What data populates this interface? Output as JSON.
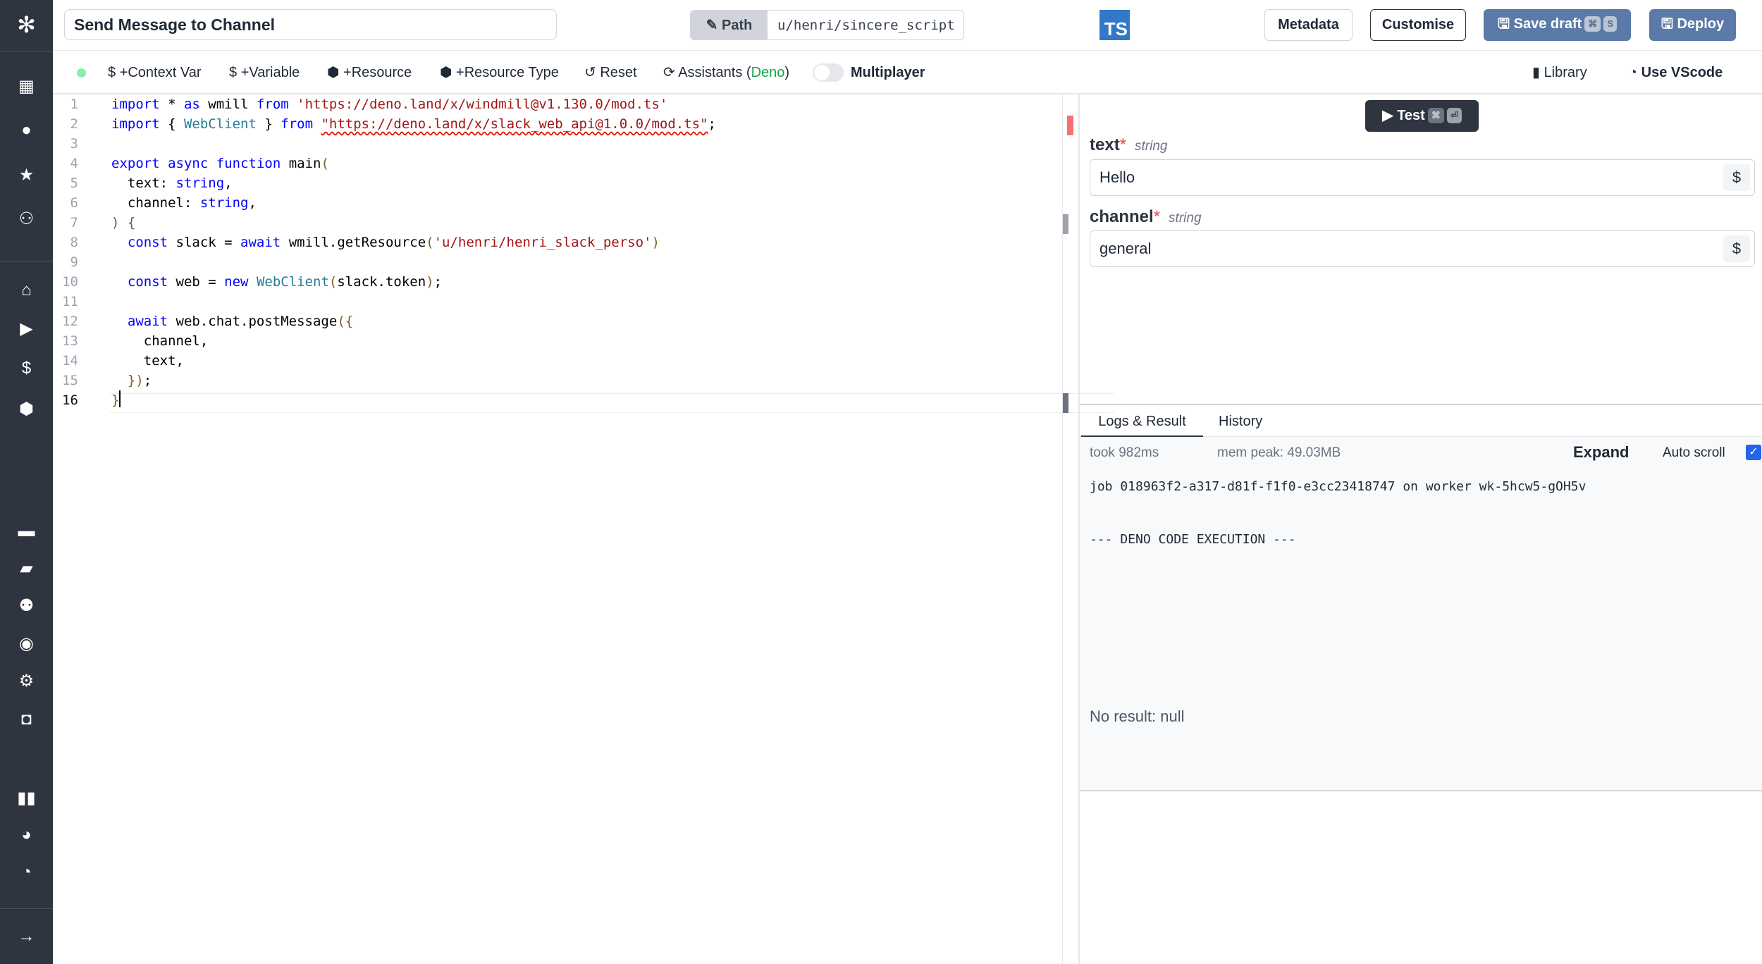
{
  "sidebar": {
    "icons": [
      "windmill-logo",
      "building-icon",
      "user-icon",
      "star-icon",
      "users-icon",
      "home-icon",
      "play-icon",
      "dollar-icon",
      "cubes-icon",
      "calendar-icon",
      "folder-icon",
      "groups-icon",
      "eye-icon",
      "gear-icon",
      "robot-icon",
      "book-icon",
      "discord-icon",
      "github-icon",
      "arrow-right-icon"
    ]
  },
  "header": {
    "title": "Send Message to Channel",
    "path_label": "Path",
    "path_value": "u/henri/sincere_script",
    "lang_badge": "TS",
    "metadata": "Metadata",
    "customise": "Customise",
    "save_draft": "Save draft",
    "save_kbd1": "⌘",
    "save_kbd2": "S",
    "deploy": "Deploy",
    "accent": "#5b7aa8"
  },
  "toolbar": {
    "context_var": "+Context Var",
    "variable": "+Variable",
    "resource": "+Resource",
    "resource_type": "+Resource Type",
    "reset": "Reset",
    "assistants": "Assistants (",
    "assistants_deno": "Deno",
    "assistants_close": ")",
    "multiplayer": "Multiplayer",
    "multiplayer_on": false,
    "library": "Library",
    "use_vscode": "Use VScode",
    "status_color": "#86efac"
  },
  "editor": {
    "lines": [
      [
        [
          "kw",
          "import"
        ],
        [
          "pl",
          " * "
        ],
        [
          "kw",
          "as"
        ],
        [
          "pl",
          " wmill "
        ],
        [
          "kw",
          "from"
        ],
        [
          "pl",
          " "
        ],
        [
          "st",
          "'https://deno.land/x/windmill@v1.130.0/mod.ts'"
        ]
      ],
      [
        [
          "kw",
          "import"
        ],
        [
          "pl",
          " { "
        ],
        [
          "ty",
          "WebClient"
        ],
        [
          "pl",
          " } "
        ],
        [
          "kw",
          "from"
        ],
        [
          "pl",
          " "
        ],
        [
          "stq",
          "\"https://deno.land/x/slack_web_api@1.0.0/mod.ts\""
        ],
        [
          "pl",
          ";"
        ]
      ],
      [],
      [
        [
          "kw",
          "export"
        ],
        [
          "pl",
          " "
        ],
        [
          "kw",
          "async"
        ],
        [
          "pl",
          " "
        ],
        [
          "kw",
          "function"
        ],
        [
          "pl",
          " main"
        ],
        [
          "br",
          "("
        ]
      ],
      [
        [
          "pl",
          "  text: "
        ],
        [
          "kw",
          "string"
        ],
        [
          "pl",
          ","
        ]
      ],
      [
        [
          "pl",
          "  channel: "
        ],
        [
          "kw",
          "string"
        ],
        [
          "pl",
          ","
        ]
      ],
      [
        [
          "br",
          ")"
        ],
        [
          "pl",
          " "
        ],
        [
          "br",
          "{"
        ]
      ],
      [
        [
          "pl",
          "  "
        ],
        [
          "kw",
          "const"
        ],
        [
          "pl",
          " slack = "
        ],
        [
          "kw",
          "await"
        ],
        [
          "pl",
          " wmill.getResource"
        ],
        [
          "br",
          "("
        ],
        [
          "st",
          "'u/henri/henri_slack_perso'"
        ],
        [
          "br",
          ")"
        ]
      ],
      [],
      [
        [
          "pl",
          "  "
        ],
        [
          "kw",
          "const"
        ],
        [
          "pl",
          " web = "
        ],
        [
          "kw",
          "new"
        ],
        [
          "pl",
          " "
        ],
        [
          "ty",
          "WebClient"
        ],
        [
          "br",
          "("
        ],
        [
          "pl",
          "slack.token"
        ],
        [
          "br",
          ")"
        ],
        [
          "pl",
          ";"
        ]
      ],
      [],
      [
        [
          "pl",
          "  "
        ],
        [
          "kw",
          "await"
        ],
        [
          "pl",
          " web.chat.postMessage"
        ],
        [
          "br",
          "({"
        ]
      ],
      [
        [
          "pl",
          "    channel,"
        ]
      ],
      [
        [
          "pl",
          "    text,"
        ]
      ],
      [
        [
          "pl",
          "  "
        ],
        [
          "br",
          "})"
        ],
        [
          "pl",
          ";"
        ]
      ],
      [
        [
          "br",
          "}"
        ]
      ]
    ]
  },
  "test": {
    "label": "Test",
    "kbd1": "⌘",
    "kbd2": "⏎"
  },
  "args": [
    {
      "name": "text",
      "type": "string",
      "value": "Hello"
    },
    {
      "name": "channel",
      "type": "string",
      "value": "general"
    }
  ],
  "results": {
    "tabs": [
      "Logs & Result",
      "History"
    ],
    "active_tab": 0,
    "took": "took 982ms",
    "mem": "mem peak: 49.03MB",
    "expand": "Expand",
    "auto_scroll": "Auto scroll",
    "auto_scroll_checked": true,
    "log_lines": [
      "job 018963f2-a317-d81f-f1f0-e3cc23418747 on worker wk-5hcw5-gOH5v",
      "--- DENO CODE EXECUTION ---"
    ],
    "result": "No result: null"
  }
}
